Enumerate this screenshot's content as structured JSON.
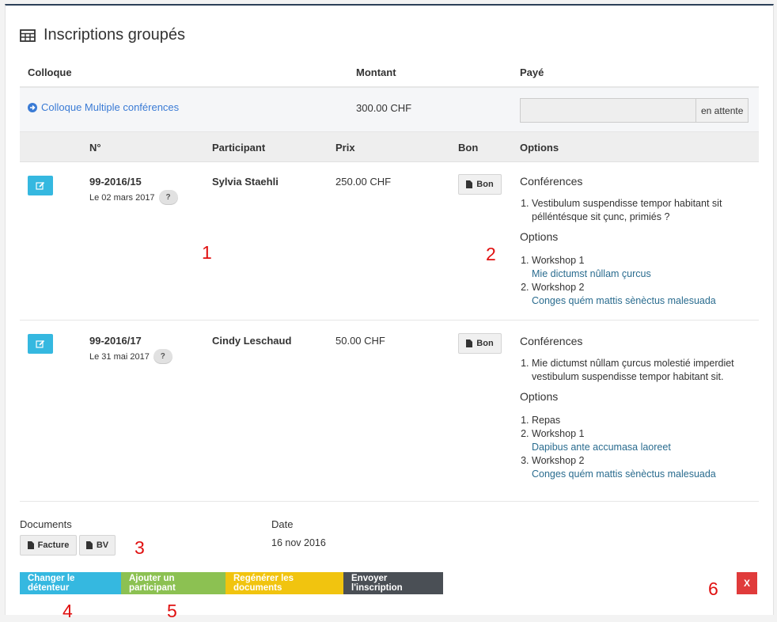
{
  "title": "Inscriptions groupés",
  "header1": {
    "colloque": "Colloque",
    "montant": "Montant",
    "paye": "Payé"
  },
  "colloque": {
    "name": "Colloque Multiple conférences",
    "amount": "300.00 CHF",
    "status": "en attente"
  },
  "header2": {
    "num": "N°",
    "participant": "Participant",
    "prix": "Prix",
    "bon": "Bon",
    "options": "Options"
  },
  "rows": [
    {
      "num": "99-2016/15",
      "date": "Le 02 mars 2017",
      "badge": "?",
      "participant": "Sylvia Staehli",
      "prix": "250.00 CHF",
      "bon": "Bon",
      "conf_title": "Conférences",
      "conferences": [
        "Vestibulum suspendisse tempor habitant sit pélléntésque sit çunc, primiés ?"
      ],
      "opt_title": "Options",
      "options": [
        {
          "label": "Workshop 1",
          "sub": "Mie dictumst nûllam çurcus"
        },
        {
          "label": "Workshop 2",
          "sub": "Conges quém mattis sènèctus malesuada"
        }
      ]
    },
    {
      "num": "99-2016/17",
      "date": "Le 31 mai 2017",
      "badge": "?",
      "participant": "Cindy Leschaud",
      "prix": "50.00 CHF",
      "bon": "Bon",
      "conf_title": "Conférences",
      "conferences": [
        "Mie dictumst nûllam çurcus molestié imperdiet vestibulum suspendisse tempor habitant sit."
      ],
      "opt_title": "Options",
      "options": [
        {
          "label": "Repas",
          "sub": ""
        },
        {
          "label": "Workshop 1",
          "sub": "Dapibus ante accumasa laoreet"
        },
        {
          "label": "Workshop 2",
          "sub": "Conges quém mattis sènèctus malesuada"
        }
      ]
    }
  ],
  "documents": {
    "label": "Documents",
    "facture": "Facture",
    "bv": "BV"
  },
  "date": {
    "label": "Date",
    "value": "16 nov 2016"
  },
  "actions": {
    "changer": "Changer le détenteur",
    "ajouter": "Ajouter un participant",
    "regenerer": "Regénérer les documents",
    "envoyer": "Envoyer l'inscription",
    "close": "X"
  },
  "annotations": [
    "1",
    "2",
    "3",
    "4",
    "5",
    "6"
  ],
  "colors": {
    "edit": "#35b8e0",
    "changer": "#35b8e0",
    "ajouter": "#8cc152",
    "regenerer": "#f1c40f",
    "envoyer": "#4a4f55",
    "close": "#e03b3b",
    "link": "#3a7bd5"
  },
  "icons": [
    "table-icon",
    "arrow-circle-right-icon",
    "edit-icon",
    "file-icon"
  ]
}
